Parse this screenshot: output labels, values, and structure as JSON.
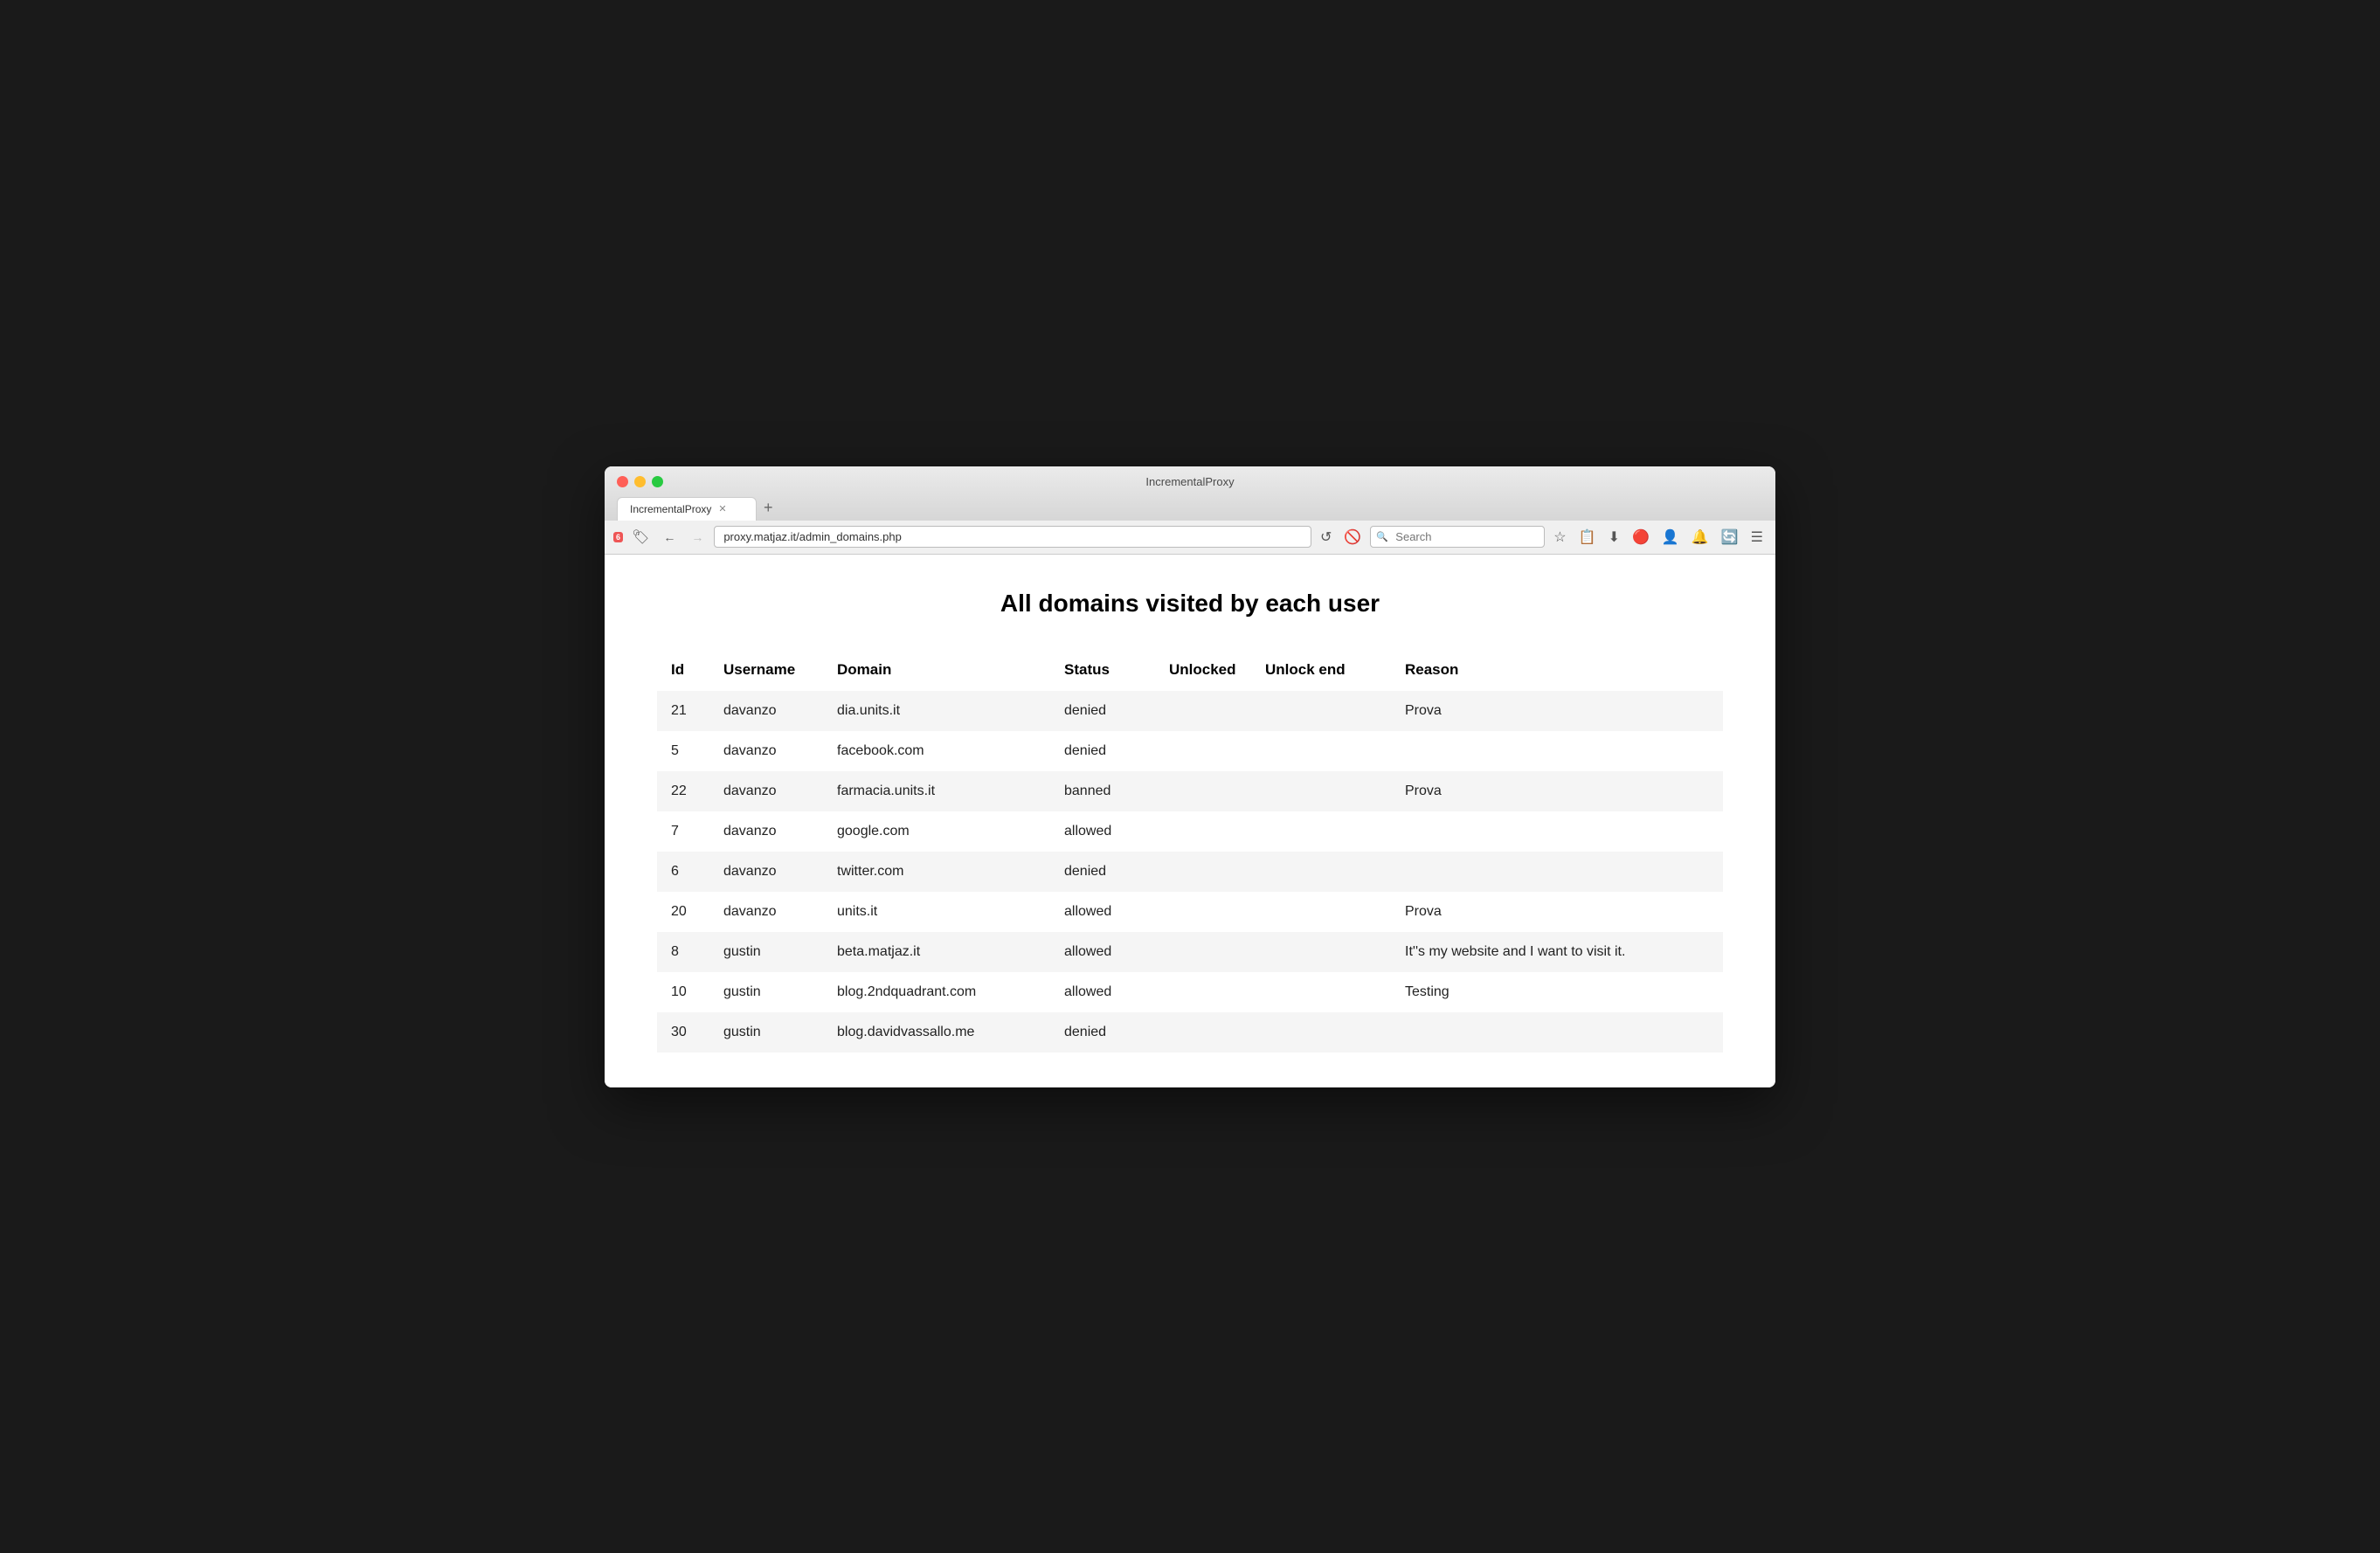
{
  "browser": {
    "title": "IncrementalProxy",
    "tab_label": "IncrementalProxy",
    "url": "proxy.matjaz.it/admin_domains.php",
    "search_placeholder": "Search"
  },
  "page": {
    "heading": "All domains visited by each user",
    "table": {
      "columns": [
        "Id",
        "Username",
        "Domain",
        "Status",
        "Unlocked",
        "Unlock end",
        "Reason"
      ],
      "rows": [
        {
          "id": "21",
          "username": "davanzo",
          "domain": "dia.units.it",
          "status": "denied",
          "unlocked": "",
          "unlock_end": "",
          "reason": "Prova"
        },
        {
          "id": "5",
          "username": "davanzo",
          "domain": "facebook.com",
          "status": "denied",
          "unlocked": "",
          "unlock_end": "",
          "reason": ""
        },
        {
          "id": "22",
          "username": "davanzo",
          "domain": "farmacia.units.it",
          "status": "banned",
          "unlocked": "",
          "unlock_end": "",
          "reason": "Prova"
        },
        {
          "id": "7",
          "username": "davanzo",
          "domain": "google.com",
          "status": "allowed",
          "unlocked": "",
          "unlock_end": "",
          "reason": ""
        },
        {
          "id": "6",
          "username": "davanzo",
          "domain": "twitter.com",
          "status": "denied",
          "unlocked": "",
          "unlock_end": "",
          "reason": ""
        },
        {
          "id": "20",
          "username": "davanzo",
          "domain": "units.it",
          "status": "allowed",
          "unlocked": "",
          "unlock_end": "",
          "reason": "Prova"
        },
        {
          "id": "8",
          "username": "gustin",
          "domain": "beta.matjaz.it",
          "status": "allowed",
          "unlocked": "",
          "unlock_end": "",
          "reason": "It''s my website and I want to visit it."
        },
        {
          "id": "10",
          "username": "gustin",
          "domain": "blog.2ndquadrant.com",
          "status": "allowed",
          "unlocked": "",
          "unlock_end": "",
          "reason": "Testing"
        },
        {
          "id": "30",
          "username": "gustin",
          "domain": "blog.davidvassallo.me",
          "status": "denied",
          "unlocked": "",
          "unlock_end": "",
          "reason": ""
        }
      ]
    }
  }
}
